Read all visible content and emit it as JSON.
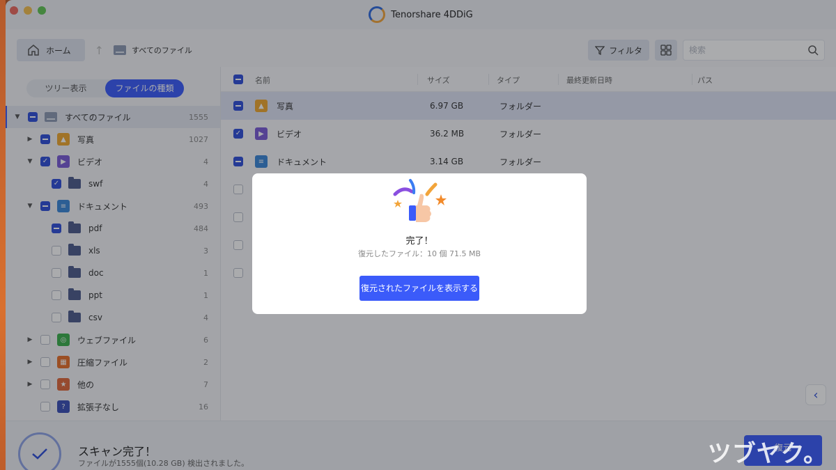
{
  "app": {
    "title": "Tenorshare 4DDiG"
  },
  "toolbar": {
    "home_label": "ホーム",
    "breadcrumb": "すべてのファイル",
    "filter_label": "フィルタ",
    "search_placeholder": "検索"
  },
  "sidebar": {
    "tabs": [
      {
        "label": "ツリー表示",
        "active": false
      },
      {
        "label": "ファイルの種類",
        "active": true
      }
    ],
    "tree": [
      {
        "label": "すべてのファイル",
        "count": "1555",
        "state": "partial",
        "caret": "down",
        "icon": "drive-icon"
      },
      {
        "label": "写真",
        "count": "1027",
        "state": "partial",
        "caret": "right",
        "icon": "photo-icon"
      },
      {
        "label": "ビデオ",
        "count": "4",
        "state": "checked",
        "caret": "down",
        "icon": "video-icon"
      },
      {
        "label": "swf",
        "count": "4",
        "state": "checked",
        "caret": "",
        "icon": "folder-icon"
      },
      {
        "label": "ドキュメント",
        "count": "493",
        "state": "partial",
        "caret": "down",
        "icon": "document-icon"
      },
      {
        "label": "pdf",
        "count": "484",
        "state": "partial",
        "caret": "",
        "icon": "folder-icon"
      },
      {
        "label": "xls",
        "count": "3",
        "state": "unchecked",
        "caret": "",
        "icon": "folder-icon"
      },
      {
        "label": "doc",
        "count": "1",
        "state": "unchecked",
        "caret": "",
        "icon": "folder-icon"
      },
      {
        "label": "ppt",
        "count": "1",
        "state": "unchecked",
        "caret": "",
        "icon": "folder-icon"
      },
      {
        "label": "csv",
        "count": "4",
        "state": "unchecked",
        "caret": "",
        "icon": "folder-icon"
      },
      {
        "label": "ウェブファイル",
        "count": "6",
        "state": "unchecked",
        "caret": "right",
        "icon": "web-icon"
      },
      {
        "label": "圧縮ファイル",
        "count": "2",
        "state": "unchecked",
        "caret": "right",
        "icon": "archive-icon"
      },
      {
        "label": "他の",
        "count": "7",
        "state": "unchecked",
        "caret": "right",
        "icon": "other-icon"
      },
      {
        "label": "拡張子なし",
        "count": "16",
        "state": "unchecked",
        "caret": "",
        "icon": "unknown-icon"
      }
    ]
  },
  "list": {
    "headers": {
      "name": "名前",
      "size": "サイズ",
      "type": "タイプ",
      "modified": "最終更新日時",
      "path": "パス"
    },
    "rows": [
      {
        "name": "写真",
        "size": "6.97 GB",
        "type": "フォルダー",
        "state": "partial",
        "icon": "photo-icon",
        "selected": true
      },
      {
        "name": "ビデオ",
        "size": "36.2 MB",
        "type": "フォルダー",
        "state": "checked",
        "icon": "video-icon",
        "selected": false
      },
      {
        "name": "ドキュメント",
        "size": "3.14 GB",
        "type": "フォルダー",
        "state": "partial",
        "icon": "document-icon",
        "selected": false
      },
      {
        "name": "",
        "size": "",
        "type": "",
        "state": "unchecked",
        "icon": "",
        "selected": false
      },
      {
        "name": "",
        "size": "",
        "type": "",
        "state": "unchecked",
        "icon": "",
        "selected": false
      },
      {
        "name": "",
        "size": "",
        "type": "",
        "state": "unchecked",
        "icon": "",
        "selected": false
      },
      {
        "name": "",
        "size": "",
        "type": "",
        "state": "unchecked",
        "icon": "",
        "selected": false
      }
    ]
  },
  "status": {
    "title": "スキャン完了！",
    "subtitle": "ファイルが1555個(10.28 GB) 検出されました。",
    "restore_label": "復元"
  },
  "modal": {
    "title": "完了！",
    "subtitle": "復元したファイル：10 個 71.5 MB",
    "button_label": "復元されたファイルを表示する"
  },
  "watermark": "ツブヤク。",
  "colors": {
    "accent": "#3b5bfa",
    "checkbox": "#2f4fd9",
    "photo": "#f0a830",
    "video": "#7b5cd6",
    "document": "#3a87d8",
    "web": "#3bb04c",
    "archive": "#e8702a",
    "other": "#e0683a",
    "unknown": "#3b4fb8"
  }
}
